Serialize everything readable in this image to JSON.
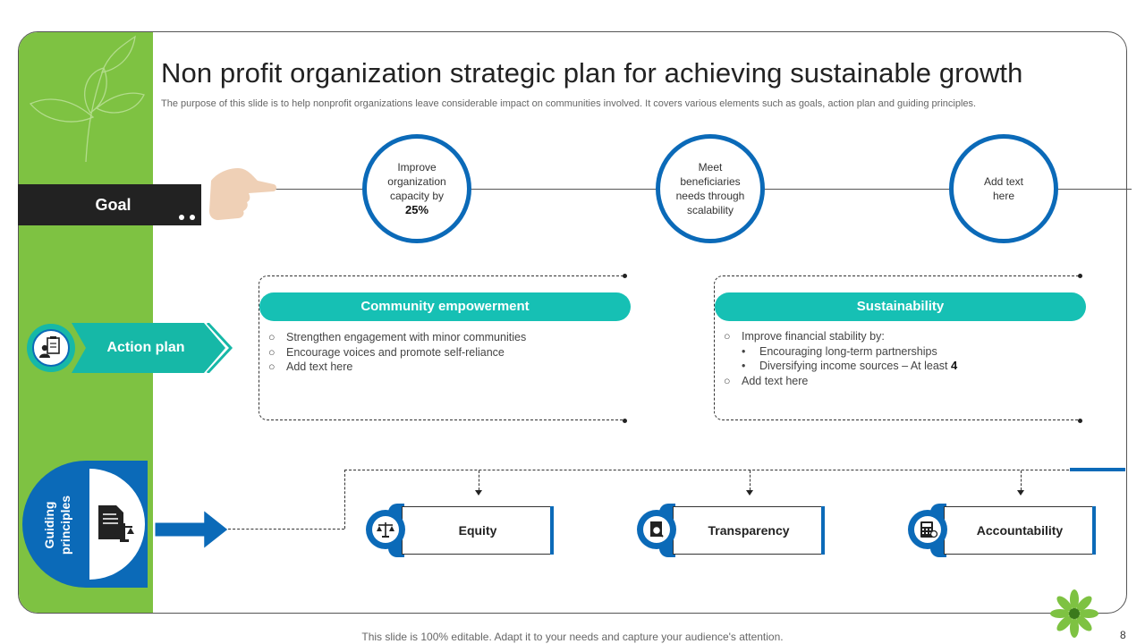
{
  "title": "Non profit organization strategic plan for achieving sustainable growth",
  "subtitle": "The purpose of this slide is to help nonprofit organizations leave considerable impact on communities involved. It covers various elements such as goals, action plan and guiding principles.",
  "goal": {
    "label": "Goal",
    "circles": [
      {
        "text": "Improve organization capacity by",
        "emphasis": "25%"
      },
      {
        "text": "Meet beneficiaries needs through scalability",
        "emphasis": ""
      },
      {
        "text": "Add text here",
        "emphasis": ""
      }
    ]
  },
  "action_plan": {
    "label": "Action plan",
    "community": {
      "heading": "Community empowerment",
      "items": [
        "Strengthen engagement with minor communities",
        "Encourage voices and promote self-reliance",
        "Add text here"
      ]
    },
    "sustainability": {
      "heading": "Sustainability",
      "item1": "Improve financial stability by:",
      "sub1": "Encouraging long-term partnerships",
      "sub2_text": "Diversifying income sources – At least",
      "sub2_emphasis": "4",
      "item2": "Add text here"
    }
  },
  "guiding_principles": {
    "label_line1": "Guiding",
    "label_line2": "principles",
    "items": [
      "Equity",
      "Transparency",
      "Accountability"
    ]
  },
  "footer": {
    "note": "This slide is 100% editable. Adapt it to your needs and capture your audience's attention.",
    "page_number": "8"
  },
  "colors": {
    "green": "#7ec242",
    "blue": "#0b6ab8",
    "teal": "#16c0b4",
    "dark": "#222222"
  },
  "icons": [
    "leaf-outline-icon",
    "pointing-hand-icon",
    "clipboard-person-icon",
    "document-scales-icon",
    "scales-icon",
    "magnifier-document-icon",
    "calculator-icon",
    "flower-logo-icon"
  ]
}
